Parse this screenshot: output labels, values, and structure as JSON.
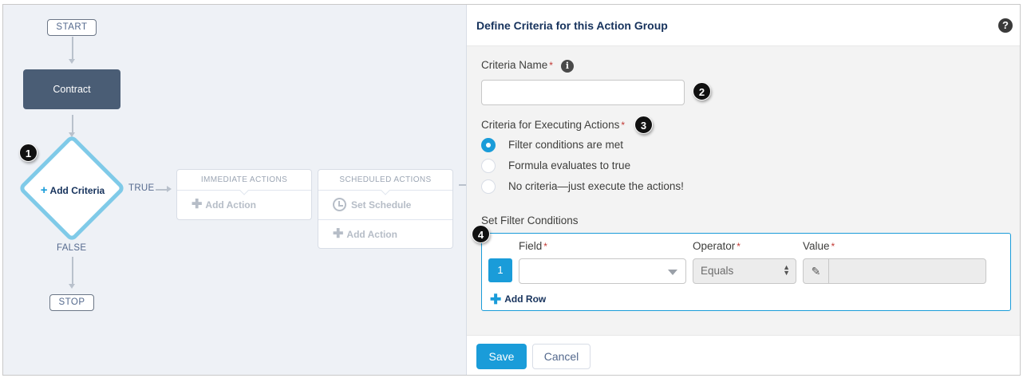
{
  "flow": {
    "start_label": "START",
    "object_label": "Contract",
    "add_criteria_label": "Add Criteria",
    "true_label": "TRUE",
    "false_label": "FALSE",
    "stop_label": "STOP",
    "immediate_actions": {
      "header": "IMMEDIATE ACTIONS",
      "add_action_label": "Add Action"
    },
    "scheduled_actions": {
      "header": "SCHEDULED ACTIONS",
      "set_schedule_label": "Set Schedule",
      "add_action_label": "Add Action"
    }
  },
  "callouts": [
    "1",
    "2",
    "3",
    "4"
  ],
  "panel": {
    "title": "Define Criteria for this Action Group",
    "criteria_name": {
      "label": "Criteria Name",
      "required_mark": "*",
      "value": ""
    },
    "criteria_for_executing": {
      "label": "Criteria for Executing Actions",
      "required_mark": "*",
      "options": [
        {
          "label": "Filter conditions are met",
          "selected": true
        },
        {
          "label": "Formula evaluates to true",
          "selected": false
        },
        {
          "label": "No criteria—just execute the actions!",
          "selected": false
        }
      ]
    },
    "filter_conditions": {
      "label": "Set Filter Conditions",
      "columns": {
        "field": "Field",
        "operator": "Operator",
        "value": "Value",
        "required_mark": "*"
      },
      "rows": [
        {
          "number": "1",
          "field": "",
          "operator": "Equals",
          "value": ""
        }
      ],
      "add_row_label": "Add Row"
    },
    "footer": {
      "save_label": "Save",
      "cancel_label": "Cancel"
    }
  },
  "colors": {
    "accent": "#1a9cd9",
    "required": "#c23934",
    "object_node": "#4a5d75",
    "criteria_border": "#7fcae8"
  },
  "icons": [
    "plus-icon",
    "clock-icon",
    "info-icon",
    "help-icon",
    "pencil-icon",
    "chevron-down-icon",
    "up-down-icon"
  ]
}
